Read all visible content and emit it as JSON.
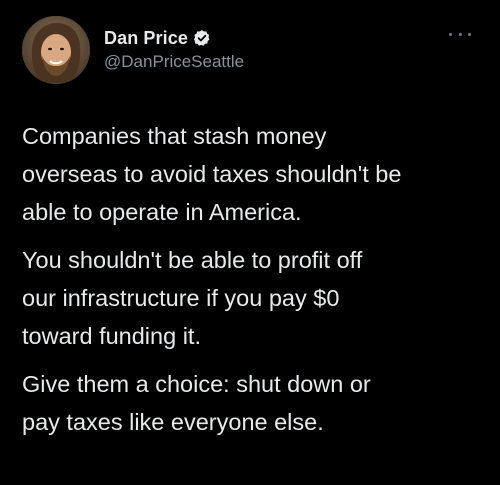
{
  "author": {
    "display_name": "Dan Price",
    "handle": "@DanPriceSeattle",
    "verified": true
  },
  "icons": {
    "verified": "verified-badge-icon",
    "more": "more-options-icon",
    "avatar": "profile-avatar"
  },
  "colors": {
    "background": "#000000",
    "primary_text": "#e7e9ea",
    "secondary_text": "#8b9197"
  },
  "tweet": {
    "paragraphs": [
      "Companies that stash money\noverseas to avoid taxes shouldn't be\nable to operate in America.",
      "You shouldn't be able to profit off\nour infrastructure if you pay $0\ntoward funding it.",
      "Give them a choice: shut down or\npay taxes like everyone else."
    ]
  }
}
